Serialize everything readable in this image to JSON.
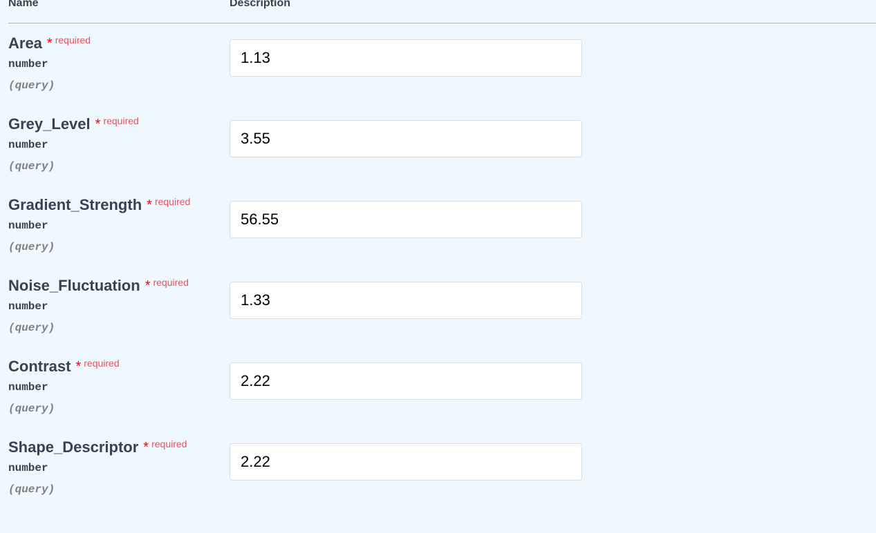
{
  "header": {
    "name_col": "Name",
    "description_col": "Description"
  },
  "params": [
    {
      "name": "Area",
      "asterisk": "*",
      "required_label": "required",
      "type": "number",
      "location": "(query)",
      "value": "1.13"
    },
    {
      "name": "Grey_Level",
      "asterisk": "*",
      "required_label": "required",
      "type": "number",
      "location": "(query)",
      "value": "3.55"
    },
    {
      "name": "Gradient_Strength",
      "asterisk": "*",
      "required_label": "required",
      "type": "number",
      "location": "(query)",
      "value": "56.55"
    },
    {
      "name": "Noise_Fluctuation",
      "asterisk": "*",
      "required_label": "required",
      "type": "number",
      "location": "(query)",
      "value": "1.33"
    },
    {
      "name": "Contrast",
      "asterisk": "*",
      "required_label": "required",
      "type": "number",
      "location": "(query)",
      "value": "2.22"
    },
    {
      "name": "Shape_Descriptor",
      "asterisk": "*",
      "required_label": "required",
      "type": "number",
      "location": "(query)",
      "value": "2.22"
    }
  ]
}
